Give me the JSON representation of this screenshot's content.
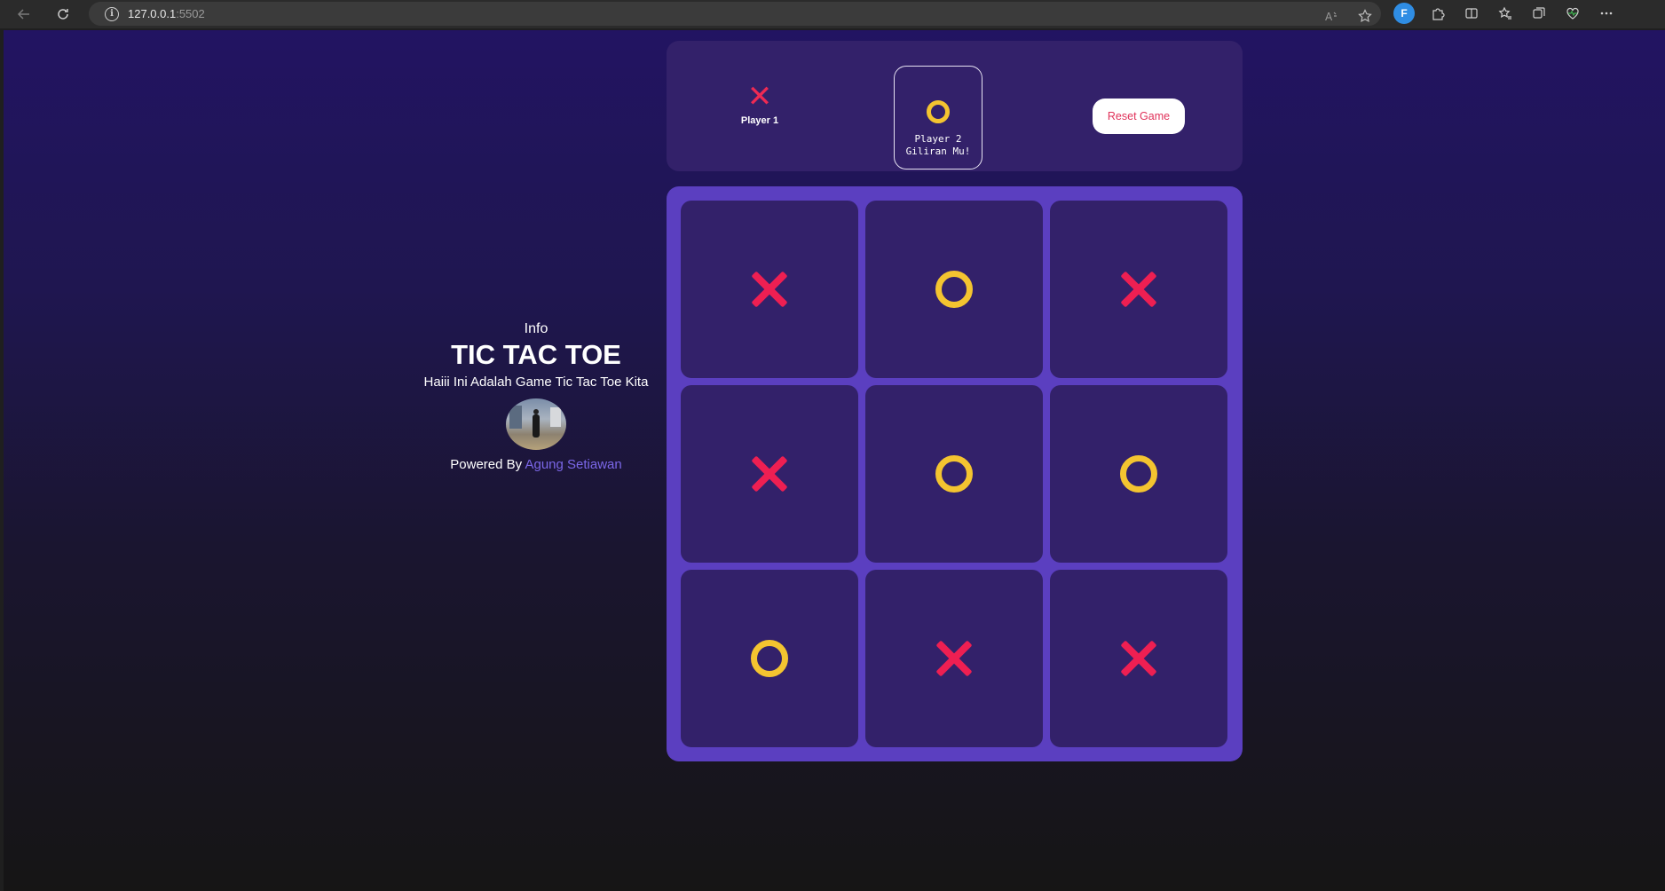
{
  "browser": {
    "url_host": "127.0.0.1",
    "url_port": ":5502",
    "extension_label": "F"
  },
  "info": {
    "label": "Info",
    "title": "TIC TAC TOE",
    "subtitle": "Haiii Ini Adalah Game Tic Tac Toe Kita",
    "powered_prefix": "Powered By ",
    "author": "Agung Setiawan"
  },
  "players": [
    {
      "mark": "X",
      "mark_glyph": "✕",
      "name": "Player 1",
      "status": ""
    },
    {
      "mark": "O",
      "name": "Player 2",
      "status": "Giliran Mu!"
    }
  ],
  "active_player": 2,
  "reset_label": "Reset Game",
  "board": [
    "X",
    "O",
    "X",
    "X",
    "O",
    "O",
    "O",
    "X",
    "X"
  ],
  "colors": {
    "x": "#ee1f52",
    "o": "#f4c430",
    "board_bg": "#5b3fc0",
    "cell_bg": "#33216a",
    "author_link": "#7b67e8"
  }
}
